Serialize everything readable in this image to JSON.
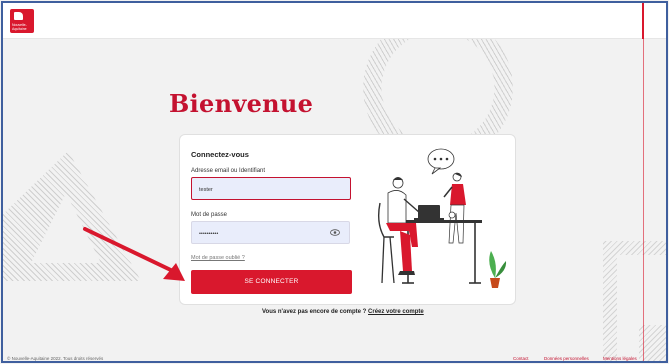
{
  "brand": {
    "logo_text": "Nouvelle-\nAquitaine",
    "accent": "#d9182d",
    "title_color": "#c41230"
  },
  "page": {
    "title": "Bienvenue"
  },
  "login": {
    "heading": "Connectez-vous",
    "email_label": "Adresse email ou Identifiant",
    "email_value": "tester",
    "password_label": "Mot de passe",
    "password_value": "••••••••••",
    "forgot_link": "Mot de passe oublié ?",
    "submit_label": "SE CONNECTER"
  },
  "signup": {
    "prompt": "Vous n'avez pas encore de compte ?",
    "link": "Créez votre compte"
  },
  "footer": {
    "copyright": "© Nouvelle-Aquitaine 2022. Tous droits réservés",
    "links": [
      "Contact",
      "Données personnelles",
      "Mentions légales"
    ]
  },
  "icons": {
    "logo": "region-logo-icon",
    "eye": "eye-icon",
    "arrow": "annotation-arrow-icon"
  }
}
